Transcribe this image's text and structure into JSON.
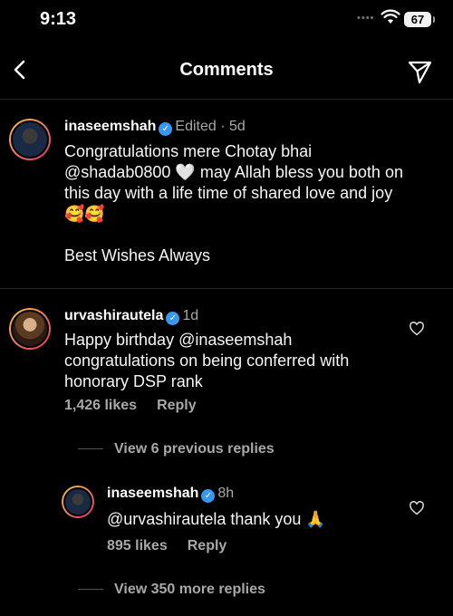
{
  "status": {
    "time": "9:13",
    "battery": "67"
  },
  "nav": {
    "title": "Comments"
  },
  "caption": {
    "username": "inaseemshah",
    "meta": "Edited · 5d",
    "text_line1": "Congratulations mere Chotay bhai",
    "text_line2a": "@shadab0800",
    "text_heart": "🤍",
    "text_line2b": "may Allah bless you both on",
    "text_line3": "this day with a life time of shared love and joy",
    "text_line4": "🥰🥰",
    "text_wishes": "Best Wishes Always"
  },
  "comment": {
    "username": "urvashirautela",
    "time": "1d",
    "line1": "Happy birthday @inaseemshah",
    "line2": "congratulations on being conferred with",
    "line3": "honorary DSP rank",
    "likes": "1,426 likes",
    "reply": "Reply",
    "view_previous": "View 6 previous replies"
  },
  "reply": {
    "username": "inaseemshah",
    "time": "8h",
    "text": "@urvashirautela thank you",
    "emoji": "🙏",
    "likes": "895 likes",
    "reply": "Reply",
    "view_more": "View 350 more replies"
  },
  "icons": {
    "back": "chevron-left-icon",
    "share": "paper-plane-icon",
    "heart": "heart-outline-icon",
    "verified": "verified-badge-icon",
    "wifi": "wifi-icon",
    "battery": "battery-icon"
  },
  "colors": {
    "background": "#000000",
    "verified": "#3897f0",
    "muted": "#a8a8a8"
  }
}
